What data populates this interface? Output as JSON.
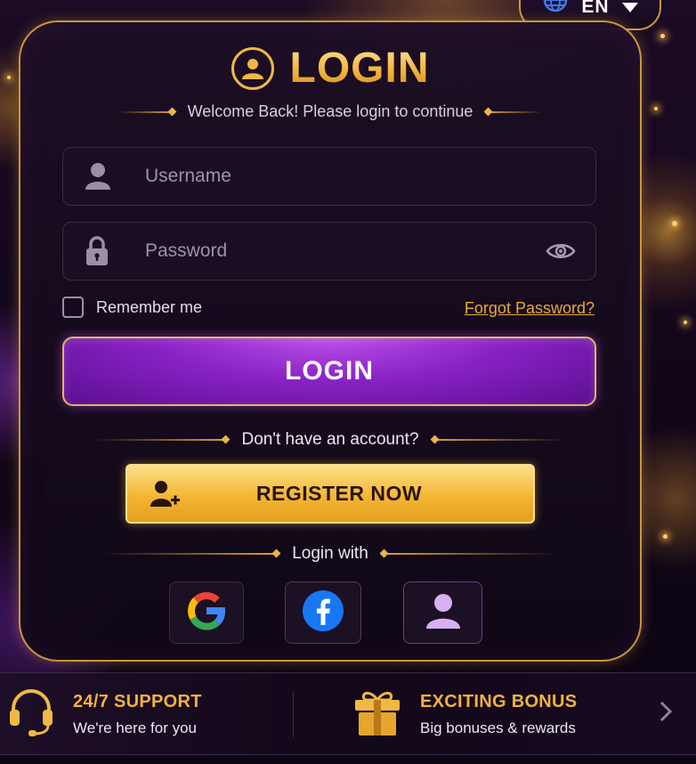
{
  "language": {
    "code": "EN",
    "icon": "globe-icon",
    "dropdown_icon": "caret-down-icon"
  },
  "header": {
    "title": "LOGIN",
    "subtitle": "Welcome Back! Please login to continue"
  },
  "form": {
    "username": {
      "placeholder": "Username",
      "value": ""
    },
    "password": {
      "placeholder": "Password",
      "value": ""
    },
    "remember_label": "Remember me",
    "remember_checked": false,
    "forgot_label": "Forgot Password?",
    "login_label": "LOGIN"
  },
  "register": {
    "prompt": "Don't have an account?",
    "button_label": "REGISTER NOW"
  },
  "social": {
    "label": "Login with",
    "providers": [
      "google",
      "facebook",
      "guest"
    ]
  },
  "footer": {
    "support": {
      "title": "24/7 SUPPORT",
      "subtitle": "We're here for you"
    },
    "bonus": {
      "title": "EXCITING BONUS",
      "subtitle": "Big bonuses & rewards"
    }
  },
  "colors": {
    "gold": "#f0b845",
    "purple": "#8a22c6",
    "background": "#120719"
  }
}
